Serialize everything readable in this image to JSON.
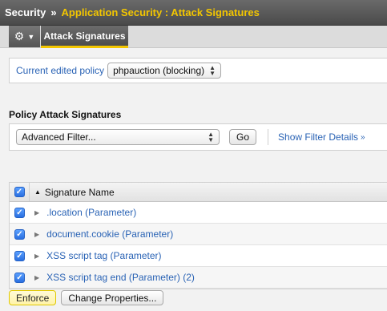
{
  "breadcrumb": {
    "root": "Security",
    "separator": "»",
    "current": "Application Security : Attack Signatures"
  },
  "tabs": {
    "menu_icon": "gear-icon",
    "active_label": "Attack Signatures"
  },
  "policy": {
    "label": "Current edited policy",
    "selected": "phpauction (blocking)"
  },
  "section_title": "Policy Attack Signatures",
  "filter": {
    "selected": "Advanced Filter...",
    "go_label": "Go",
    "details_link": "Show Filter Details"
  },
  "table": {
    "column_header": "Signature Name",
    "rows": [
      {
        "name": ".location (Parameter)",
        "checked": true
      },
      {
        "name": "document.cookie (Parameter)",
        "checked": true
      },
      {
        "name": "XSS script tag (Parameter)",
        "checked": true
      },
      {
        "name": "XSS script tag end (Parameter) (2)",
        "checked": true
      }
    ]
  },
  "actions": {
    "enforce_label": "Enforce",
    "change_label": "Change Properties..."
  },
  "colors": {
    "accent": "#f3c600",
    "link": "#2a63b5"
  }
}
